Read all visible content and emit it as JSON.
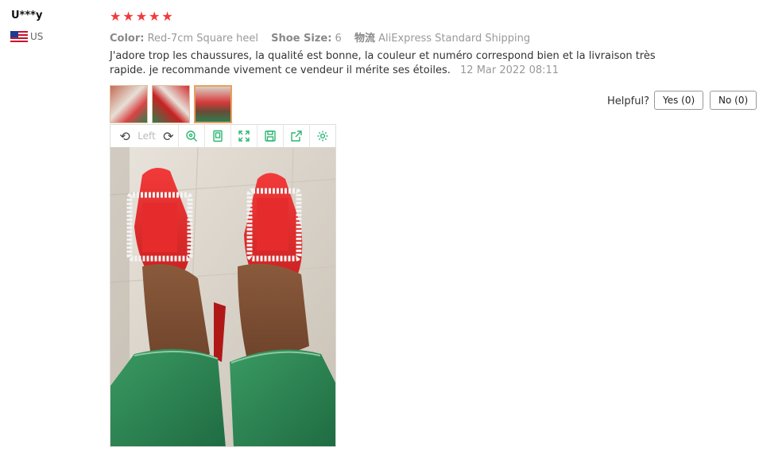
{
  "review": {
    "username": "U***y",
    "country": "US",
    "rating": 5,
    "attributes": [
      {
        "label": "Color:",
        "value": "Red-7cm Square heel"
      },
      {
        "label": "Shoe Size:",
        "value": "6"
      },
      {
        "label": "物流",
        "value": "AliExpress Standard Shipping"
      }
    ],
    "text": "J'adore trop les chaussures, la qualité est bonne, la couleur et numéro correspond bien et la livraison très rapide. je recommande vivement ce vendeur il mérite ses étoiles.",
    "date": "12 Mar 2022 08:11"
  },
  "helpful": {
    "label": "Helpful?",
    "yes": "Yes (0)",
    "no": "No (0)"
  },
  "viewer": {
    "rotate_left_icon": "rotate-left-icon",
    "left_label": "Left",
    "rotate_right_icon": "rotate-right-icon",
    "tools": [
      "zoom-icon",
      "original-size-icon",
      "fullscreen-icon",
      "save-icon",
      "share-icon",
      "settings-icon"
    ],
    "accent": "#2bb673"
  },
  "colors": {
    "star": "#f23a3a",
    "muted": "#999999",
    "thumb_active_border": "#e8a060"
  }
}
